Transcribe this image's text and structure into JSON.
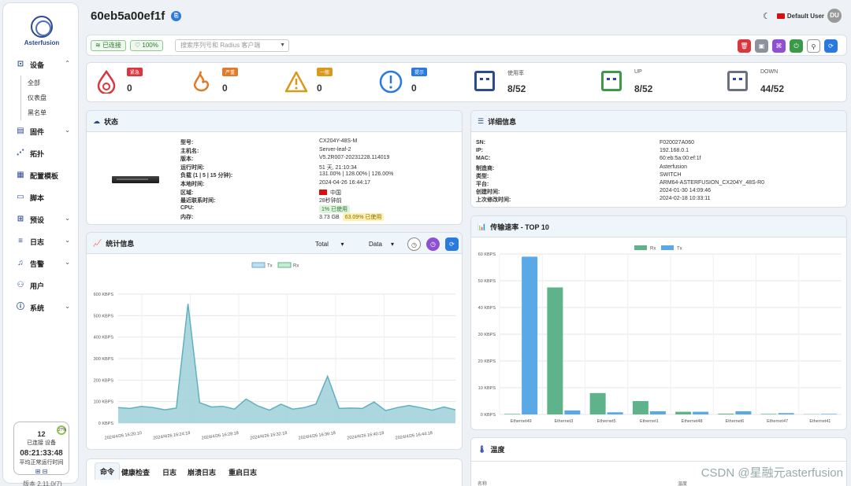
{
  "sidebar": {
    "logo_text": "Asterfusion",
    "items": [
      {
        "label": "设备",
        "icon": "device-icon",
        "expandable": true,
        "sub": [
          "全部",
          "仪表盘",
          "黑名单"
        ]
      },
      {
        "label": "固件",
        "icon": "firmware-icon",
        "expandable": true
      },
      {
        "label": "拓扑",
        "icon": "topology-icon",
        "expandable": false
      },
      {
        "label": "配置模板",
        "icon": "template-icon",
        "expandable": false
      },
      {
        "label": "脚本",
        "icon": "script-icon",
        "expandable": false
      },
      {
        "label": "预设",
        "icon": "preset-icon",
        "expandable": true
      },
      {
        "label": "日志",
        "icon": "log-icon",
        "expandable": true
      },
      {
        "label": "告警",
        "icon": "alarm-bell-icon",
        "expandable": true
      },
      {
        "label": "用户",
        "icon": "users-icon",
        "expandable": false
      },
      {
        "label": "系统",
        "icon": "info-icon",
        "expandable": true
      }
    ],
    "uptime": {
      "count": "12",
      "connected_label": "已连接 设备",
      "time": "08:21:33:48",
      "avg_label": "平均正常运行时间",
      "percent": "27%"
    },
    "version": "版本 2.11.0(7)"
  },
  "header": {
    "title": "60eb5a00ef1f",
    "user": "Default User",
    "avatar": "DU"
  },
  "toolbar": {
    "connected": "已连接",
    "health": "100%",
    "search_placeholder": "搜索序列号和 Radius 客户端"
  },
  "alarms": [
    {
      "label": "紧急",
      "count": "0",
      "color": "#d9363e",
      "icon": "critical-icon"
    },
    {
      "label": "严重",
      "count": "0",
      "color": "#e07b2a",
      "icon": "major-fire-icon"
    },
    {
      "label": "一般",
      "count": "0",
      "color": "#d89a1c",
      "icon": "warning-triangle-icon"
    },
    {
      "label": "提示",
      "count": "0",
      "color": "#2a7ade",
      "icon": "info-circle-icon"
    }
  ],
  "ports": [
    {
      "label": "使用率",
      "value": "8/52",
      "color": "#2c4a92"
    },
    {
      "label": "UP",
      "value": "8/52",
      "color": "#3a9a4a"
    },
    {
      "label": "DOWN",
      "value": "44/52",
      "color": "#6a7280"
    }
  ],
  "status": {
    "title": "状态",
    "rows": [
      {
        "k": "型号:",
        "v": "CX204Y-48S-M"
      },
      {
        "k": "主机名:",
        "v": "Server-leaf-2"
      },
      {
        "k": "版本:",
        "v": "V5.2R007-20231228.114019"
      },
      {
        "k": "运行时间:",
        "v": "51 天, 21:10:34"
      },
      {
        "k": "负载 (1 | 5 | 15 分钟):",
        "v": "131.00% | 128.00% | 126.00%"
      },
      {
        "k": "本地时间:",
        "v": "2024-04-26 16:44:17"
      },
      {
        "k": "区域:",
        "v": "中国"
      },
      {
        "k": "最近联系时间:",
        "v": "28秒钟前"
      },
      {
        "k": "CPU:",
        "v": "1% 已使用"
      },
      {
        "k": "内存:",
        "v": "3.73 GB",
        "extra": "63.09% 已使用"
      }
    ]
  },
  "details": {
    "title": "详细信息",
    "rows": [
      {
        "k": "SN:",
        "v": "F020027A060"
      },
      {
        "k": "IP:",
        "v": "192.168.0.1"
      },
      {
        "k": "MAC:",
        "v": "60:eb:5a:00:ef:1f"
      },
      {
        "k": "制造商:",
        "v": "Asterfusion"
      },
      {
        "k": "类型:",
        "v": "SWITCH"
      },
      {
        "k": "平台:",
        "v": "ARM64-ASTERFUSION_CX204Y_48S-R0"
      },
      {
        "k": "创建时间:",
        "v": "2024-01-30 14:09:46"
      },
      {
        "k": "上次修改时间:",
        "v": "2024-02-18 10:33:11"
      }
    ]
  },
  "stats": {
    "title": "统计信息",
    "select1": "Total",
    "select2": "Data"
  },
  "transfer": {
    "title": "传输速率 - TOP 10"
  },
  "temperature": {
    "title": "温度",
    "col1": "名称",
    "col2": "温度"
  },
  "tabs": [
    "命令",
    "健康检查",
    "日志",
    "崩溃日志",
    "重启日志"
  ],
  "watermark": "CSDN @星融元asterfusion",
  "chart_data": [
    {
      "type": "area",
      "title": "",
      "legend": [
        "Tx",
        "Rx"
      ],
      "legend_placement": "top-center",
      "yticks": [
        "0 KBPS",
        "100 KBPS",
        "200 KBPS",
        "300 KBPS",
        "400 KBPS",
        "500 KBPS",
        "600 KBPS"
      ],
      "ylim": [
        0,
        600
      ],
      "xticks": [
        "2024/4/26 16:20:10",
        "2024/4/26 16:24:18",
        "2024/4/26 16:28:18",
        "2024/4/26 16:32:18",
        "2024/4/26 16:36:18",
        "2024/4/26 16:40:18",
        "2024/4/26 16:44:18"
      ],
      "series": [
        {
          "name": "Tx",
          "values": [
            72,
            68,
            78,
            72,
            62,
            70,
            555,
            95,
            75,
            78,
            65,
            112,
            80,
            60,
            88,
            65,
            72,
            88,
            218,
            68,
            70,
            68,
            98,
            58,
            72,
            82,
            72,
            60,
            75,
            62
          ]
        },
        {
          "name": "Rx",
          "values": [
            0,
            0,
            0,
            0,
            0,
            0,
            0,
            0,
            0,
            0,
            0,
            0,
            0,
            0,
            0,
            0,
            0,
            0,
            0,
            0,
            0,
            0,
            0,
            0,
            0,
            0,
            0,
            0,
            0,
            0
          ]
        }
      ],
      "grid": true
    },
    {
      "type": "bar",
      "title": "传输速率 - TOP 10",
      "legend": [
        "Rx",
        "Tx"
      ],
      "legend_placement": "top-center",
      "ylim": [
        0,
        60
      ],
      "yticks": [
        "0 KBPS",
        "10 KBPS",
        "20 KBPS",
        "30 KBPS",
        "40 KBPS",
        "50 KBPS",
        "60 KBPS"
      ],
      "categories": [
        "Ethernet49",
        "Ethernet3",
        "Ethernet5",
        "Ethernet1",
        "Ethernet48",
        "Ethernet6",
        "Ethernet47",
        "Ethernet41"
      ],
      "series": [
        {
          "name": "Rx",
          "values": [
            0.2,
            47.5,
            8,
            5,
            1,
            0.3,
            0.2,
            0.1
          ],
          "color": "#5fb38a"
        },
        {
          "name": "Tx",
          "values": [
            59,
            1.5,
            0.8,
            1.2,
            1,
            1.2,
            0.5,
            0.2
          ],
          "color": "#5aa8e6"
        }
      ],
      "grid": true
    }
  ]
}
